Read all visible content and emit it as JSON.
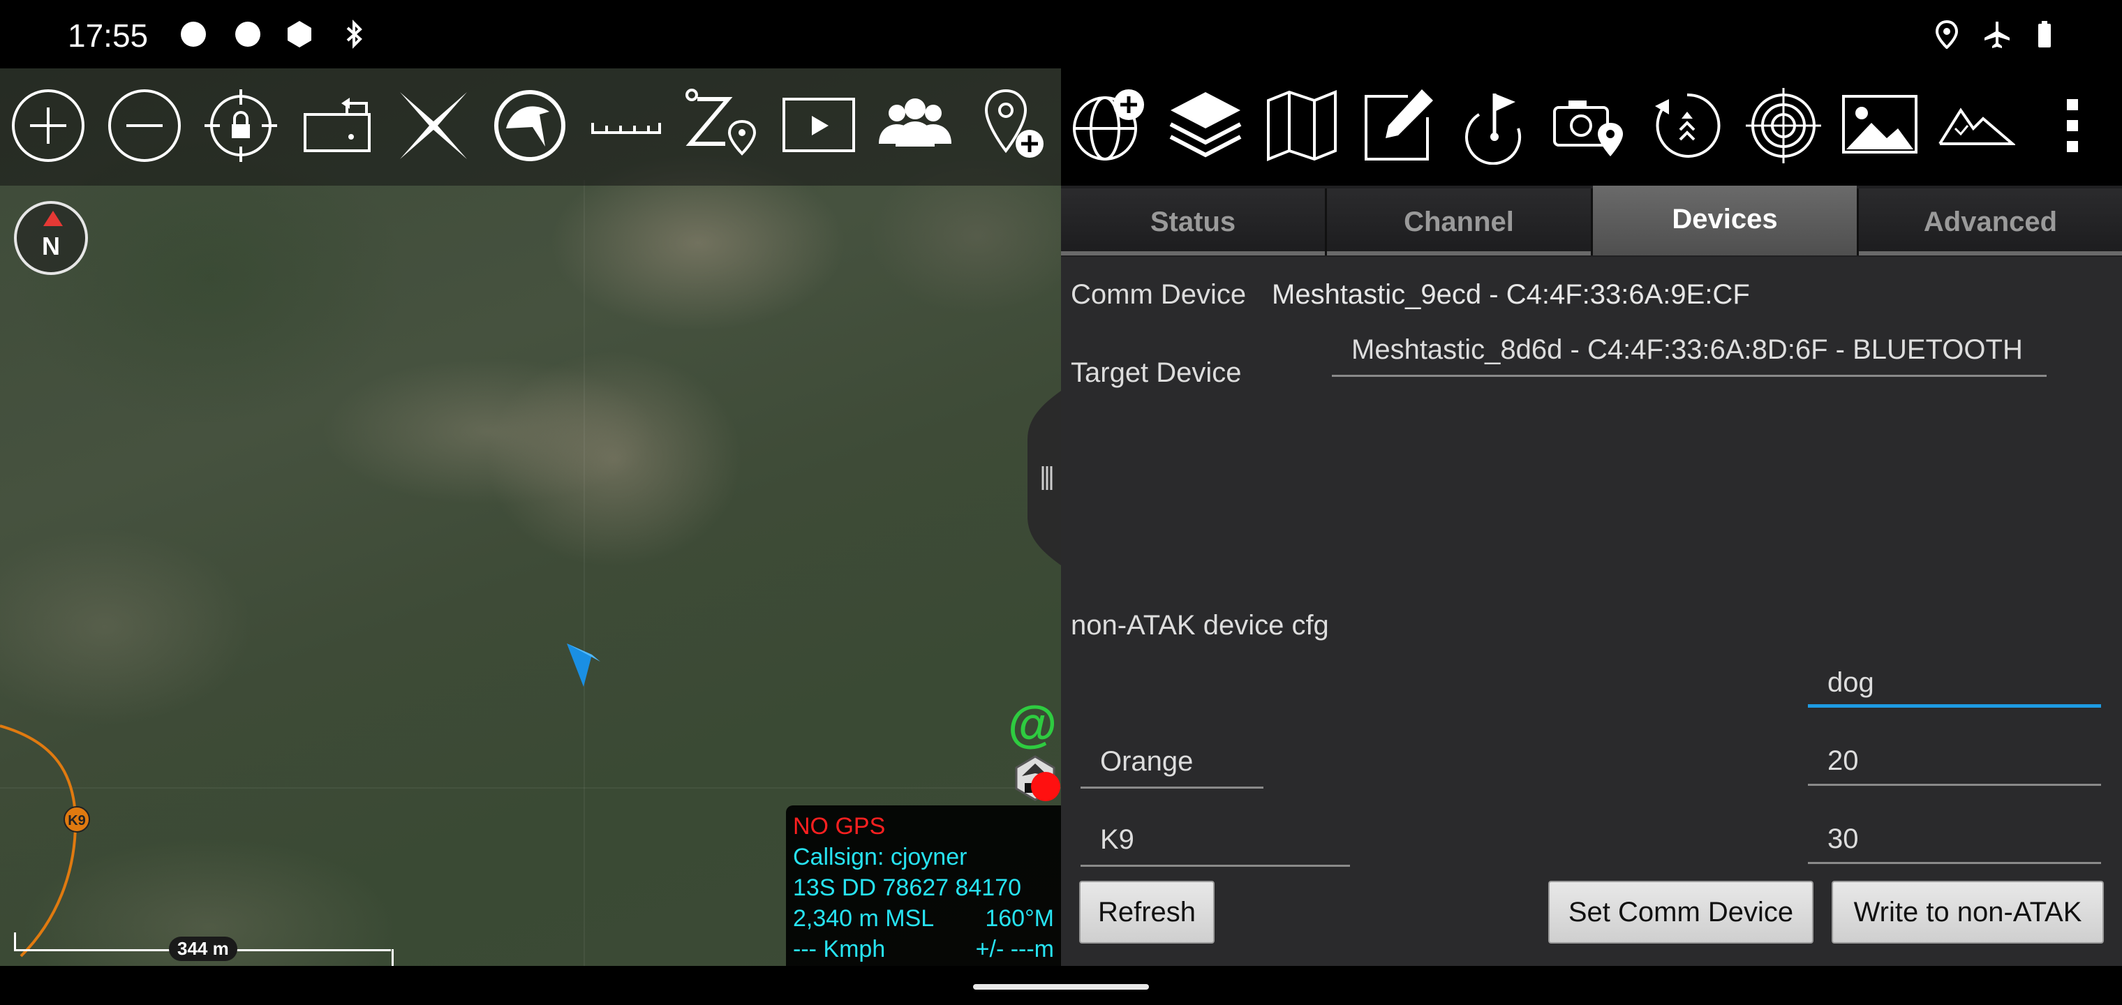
{
  "status_bar": {
    "time": "17:55",
    "left_icons": [
      "notification-dot-icon",
      "notification-dot-icon",
      "shield-icon",
      "bluetooth-icon"
    ],
    "right_icons": [
      "location-icon",
      "airplane-mode-icon",
      "battery-icon"
    ]
  },
  "map": {
    "compass_label": "N",
    "scale_label": "344 m",
    "track_marker_label": "K9",
    "info": {
      "gps_status": "NO GPS",
      "callsign": "Callsign: cjoyner",
      "grid": "13S  DD  78627  84170",
      "elevation": "2,340 m MSL",
      "heading": "160°M",
      "speed": "--- Kmph",
      "accuracy": "+/- ---m"
    },
    "toolbar_icons": [
      "zoom-in-icon",
      "zoom-out-icon",
      "lock-gps-icon",
      "rotate-map-icon",
      "cancel-x-icon",
      "nav-tools-icon",
      "ruler-icon",
      "route-icon",
      "video-icon",
      "contacts-icon",
      "add-point-icon"
    ]
  },
  "pane_toolbar_icons": [
    "globe-add-icon",
    "layers-icon",
    "map-icon",
    "edit-icon",
    "checkpoint-flag-icon",
    "geo-camera-icon",
    "back-icon",
    "target-icon",
    "gallery-icon",
    "elevation-icon",
    "overflow-menu-icon"
  ],
  "tabs": [
    "Status",
    "Channel",
    "Devices",
    "Advanced"
  ],
  "active_tab": "Devices",
  "devices": {
    "comm_device_label": "Comm Device",
    "comm_device_value": "Meshtastic_9ecd - C4:4F:33:6A:9E:CF",
    "target_device_label": "Target Device",
    "target_device_value": "Meshtastic_8d6d - C4:4F:33:6A:8D:6F - BLUETOOTH",
    "non_atak_label": "non-ATAK device cfg",
    "fields": {
      "name": "dog",
      "team": "Orange",
      "team_interval": "20",
      "role": "K9",
      "role_interval": "30"
    },
    "buttons": {
      "refresh": "Refresh",
      "set_comm": "Set Comm Device",
      "write": "Write to non-ATAK"
    }
  }
}
